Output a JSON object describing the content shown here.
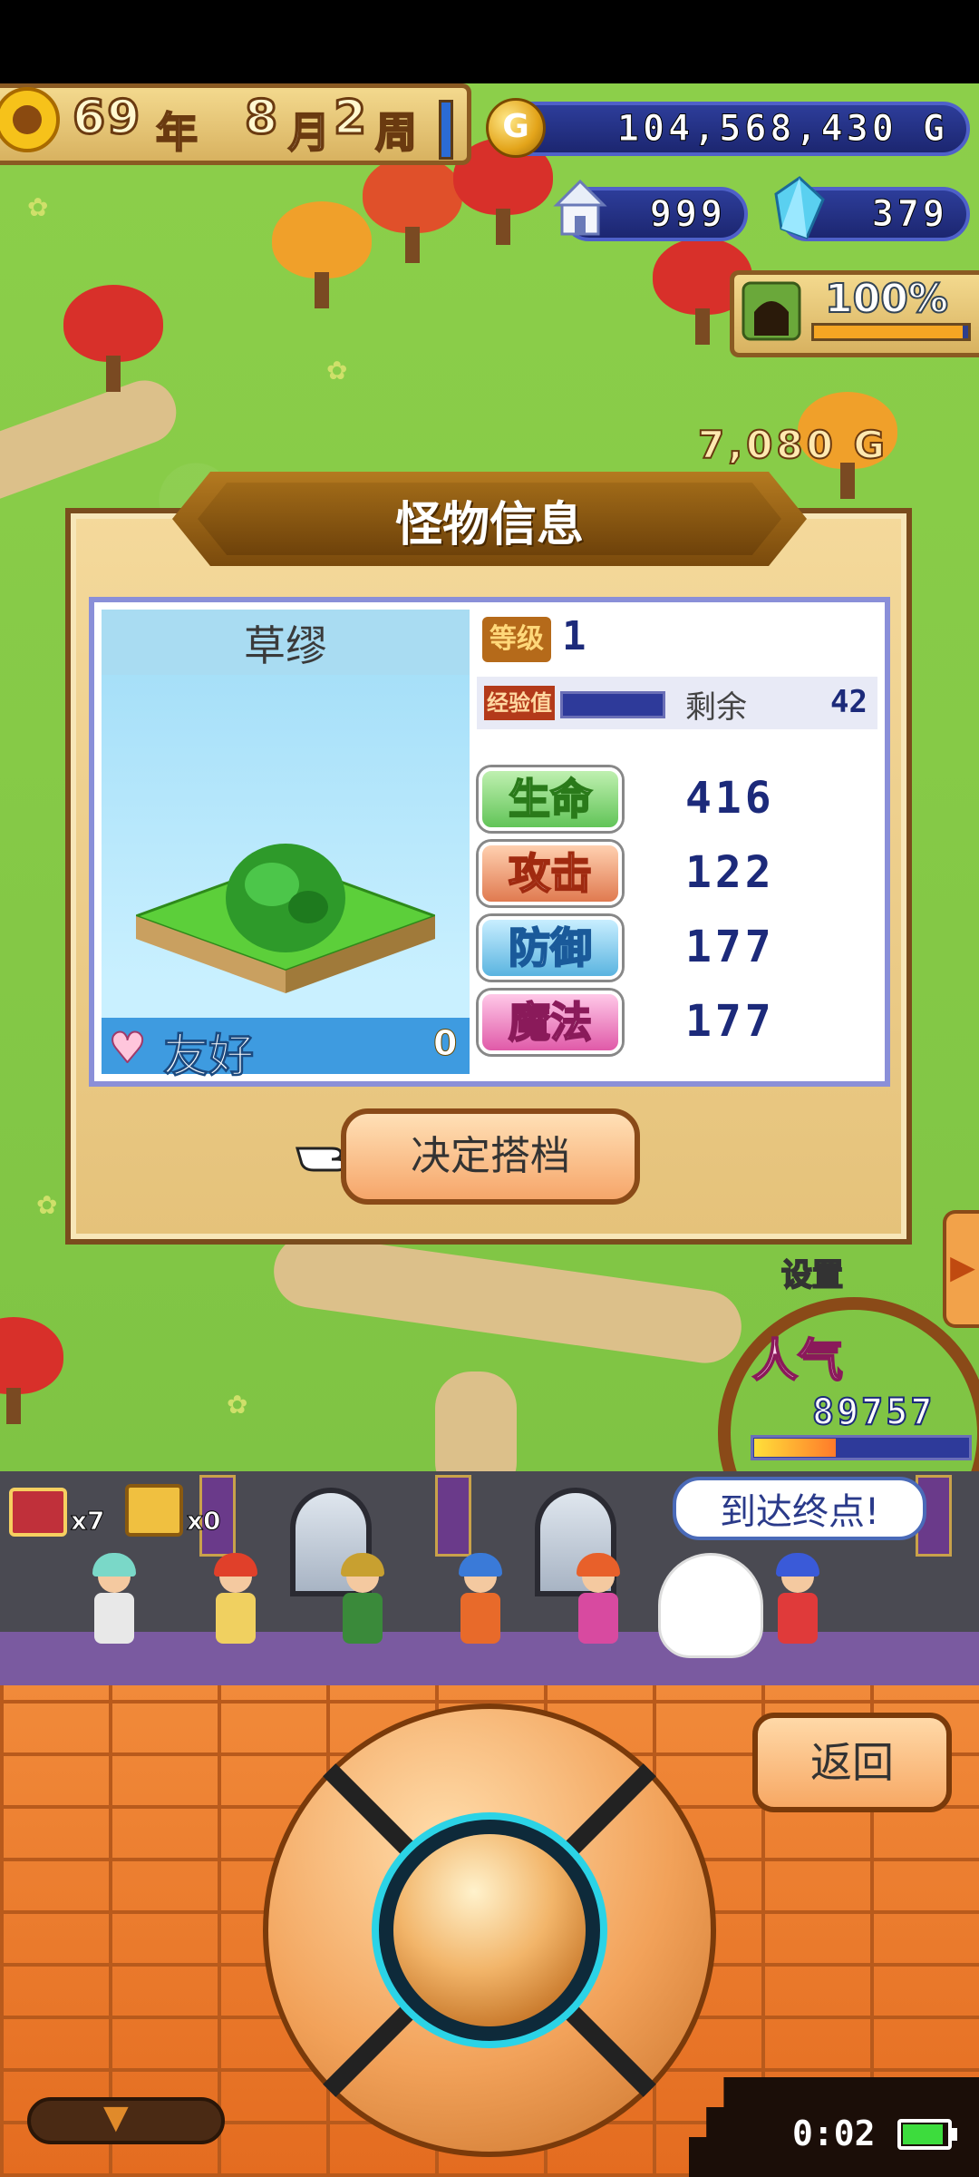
{
  "hud": {
    "year": "69",
    "year_label": "年",
    "month": "8",
    "month_label": "月",
    "week": "2",
    "week_label": "周",
    "gold": "104,568,430 G",
    "gold_coin_glyph": "G",
    "houses": "999",
    "crystals": "379",
    "dungeon_progress": "100%",
    "dungeon_progress_fraction": 1.0,
    "floating_gold": "7,080 G"
  },
  "dialog": {
    "title": "怪物信息",
    "monster_name": "草缪",
    "level_label": "等级",
    "level": "1",
    "exp_label": "经验值",
    "remaining_label": "剩余",
    "remaining_value": "42",
    "stats": [
      {
        "label": "生命",
        "value": "416"
      },
      {
        "label": "攻击",
        "value": "122"
      },
      {
        "label": "防御",
        "value": "177"
      },
      {
        "label": "魔法",
        "value": "177"
      }
    ],
    "friendship_label": "友好",
    "friendship_value": "0",
    "confirm_label": "决定搭档"
  },
  "side": {
    "settings_label": "设置",
    "popularity_label": "人气",
    "popularity_value": "89757",
    "popularity_fraction": 0.38
  },
  "castle": {
    "red_chest_count": "x7",
    "gold_chest_count": "x0",
    "speech": "到达终点!"
  },
  "controls": {
    "back_label": "返回",
    "clock": "0:02"
  },
  "icons": {
    "sun": "sun-icon",
    "coin": "gold-coin-icon",
    "house": "house-icon",
    "crystal": "crystal-icon",
    "cave": "cave-icon",
    "heart": "heart-icon",
    "pointer": "pointing-hand-icon",
    "battery": "battery-icon",
    "collapse": "chevron-down-icon"
  },
  "colors": {
    "hud_panel": "#f3d98e",
    "pill_blue": "#2d3d9a",
    "dialog_bg": "#f4d99b",
    "button_orange": "#f6a66a",
    "brick": "#e46c20"
  }
}
